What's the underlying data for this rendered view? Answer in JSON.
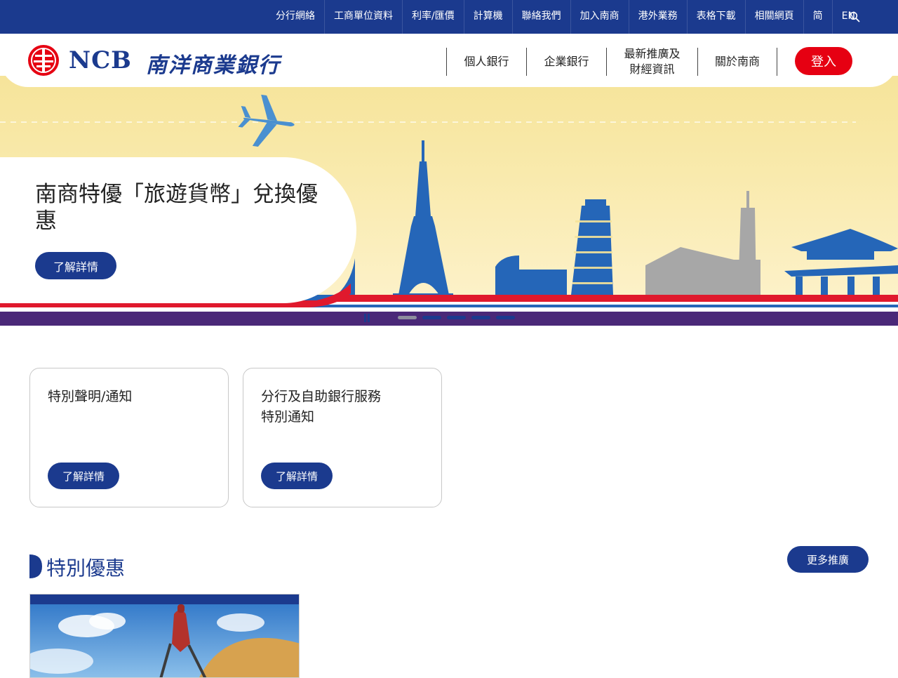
{
  "top_nav": {
    "items": [
      "分行網絡",
      "工商單位資料",
      "利率/匯價",
      "計算機",
      "聯絡我們",
      "加入南商",
      "港外業務",
      "表格下載",
      "相關網頁",
      "简",
      "EN"
    ],
    "search_icon": "search-icon"
  },
  "header": {
    "logo_en": "NCB",
    "logo_zh": "南洋商業銀行",
    "main_nav": [
      "個人銀行",
      "企業銀行",
      "最新推廣及\n財經資訊",
      "關於南商"
    ],
    "login_label": "登入"
  },
  "hero": {
    "title": "南商特優「旅遊貨幣」兌換優惠",
    "button_label": "了解詳情",
    "slide_count": 5,
    "active_slide": 1
  },
  "notices": [
    {
      "title": "特別聲明/通知",
      "button_label": "了解詳情"
    },
    {
      "title": "分行及自助銀行服務\n特別通知",
      "button_label": "了解詳情"
    }
  ],
  "offers": {
    "section_title": "特別優惠",
    "more_label": "更多推廣"
  },
  "colors": {
    "brand_blue": "#1b3a8e",
    "login_red": "#e60012",
    "hero_yellow": "#f6e49a",
    "strip_purple": "#4a2878"
  }
}
